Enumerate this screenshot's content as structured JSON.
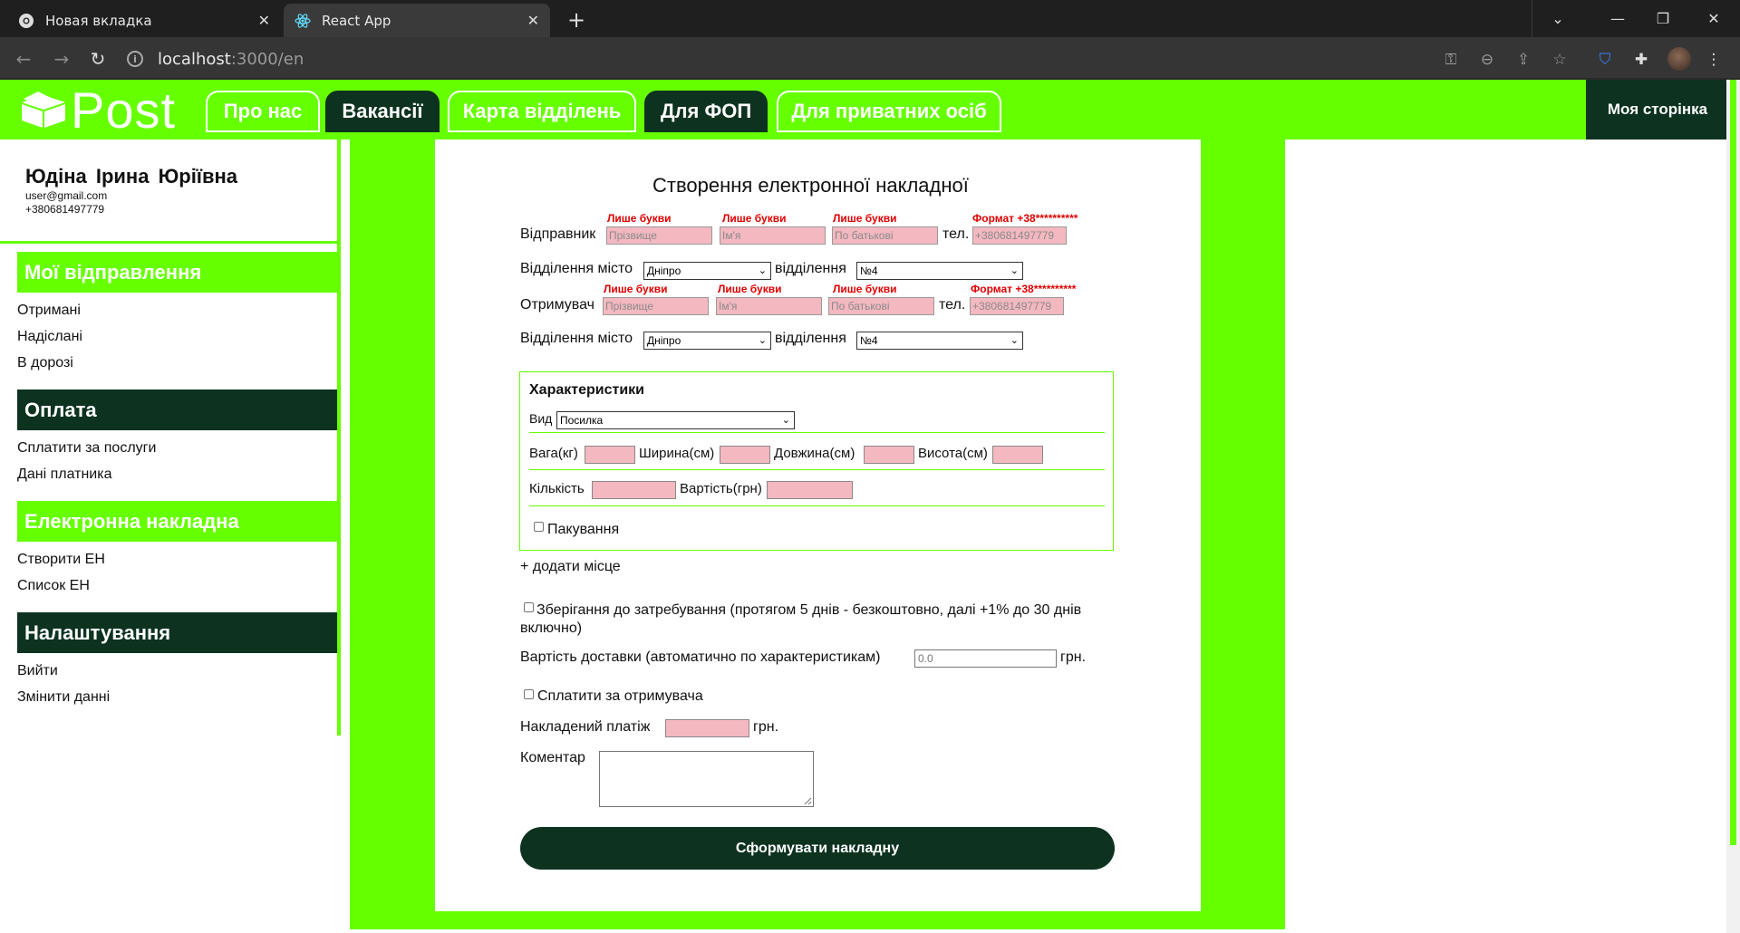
{
  "browser": {
    "tabs": [
      {
        "label": "Новая вкладка",
        "icon": "chrome-icon",
        "active": false
      },
      {
        "label": "React App",
        "icon": "react-icon",
        "active": true
      }
    ],
    "url_host": "localhost",
    "url_path": ":3000/en"
  },
  "header": {
    "logo_text": "Post",
    "nav": [
      {
        "label": "Про нас",
        "style": "green"
      },
      {
        "label": "Вакансії",
        "style": "dark"
      },
      {
        "label": "Карта відділень",
        "style": "green"
      },
      {
        "label": "Для ФОП",
        "style": "dark"
      },
      {
        "label": "Для приватних осіб",
        "style": "green"
      }
    ],
    "my_page": "Моя сторінка"
  },
  "sidebar": {
    "user_name": "Юдіна Ірина Юріївна",
    "user_email": "user@gmail.com",
    "user_phone": "+380681497779",
    "sections": [
      {
        "title": "Мої відправлення",
        "style": "green",
        "items": [
          "Отримані",
          "Надіслані",
          "В дорозі"
        ]
      },
      {
        "title": "Оплата",
        "style": "dark",
        "items": [
          "Сплатити за послуги",
          "Дані платника"
        ]
      },
      {
        "title": "Електронна накладна",
        "style": "green",
        "items": [
          "Створити ЕН",
          "Список ЕН"
        ]
      },
      {
        "title": "Налаштування",
        "style": "dark",
        "items": [
          "Вийти",
          "Змінити данні"
        ]
      }
    ]
  },
  "form": {
    "title": "Створення електронної накладної",
    "error_letters": "Лише букви",
    "error_phone": "Формат +38**********",
    "sender_label": "Відправник",
    "receiver_label": "Отримувач",
    "surname_placeholder": "Прізвище",
    "name_placeholder": "Ім'я",
    "patronymic_placeholder": "По батькові",
    "phone_label": "тел.",
    "phone_placeholder": "+380681497779",
    "branch_city_label": "Відділення місто",
    "branch_label": "відділення",
    "city_value": "Дніпро",
    "branch_value": "№4",
    "characteristics_title": "Характеристики",
    "type_label": "Вид",
    "type_value": "Посилка",
    "weight_label": "Вага(кг)",
    "width_label": "Ширина(см)",
    "length_label": "Довжина(см)",
    "height_label": "Висота(см)",
    "quantity_label": "Кількість",
    "value_label": "Вартість(грн)",
    "packing_label": "Пакування",
    "add_place": "+ додати місце",
    "storage_label": "Зберігання до затребування (протягом 5 днів - безкоштовно, далі +1% до 30 днів включно)",
    "delivery_cost_label": "Вартість доставки (автоматично по характеристикам)",
    "delivery_cost_value": "0.0",
    "currency": "грн.",
    "pay_by_receiver_label": "Сплатити за отримувача",
    "cod_label": "Накладений платіж",
    "comment_label": "Коментар",
    "submit_label": "Сформувати накладну"
  },
  "colors": {
    "accent_green": "#66ff00",
    "dark_green": "#0d3320",
    "error_red": "#e00000",
    "input_pink": "#f4b8c0"
  }
}
